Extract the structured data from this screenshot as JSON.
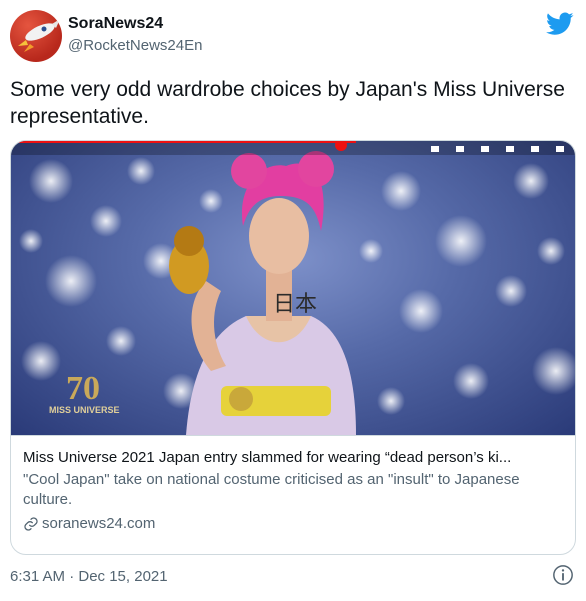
{
  "account": {
    "display_name": "SoraNews24",
    "handle": "@RocketNews24En"
  },
  "icons": {
    "avatar": "rocket-avatar-icon",
    "brand": "twitter-bird-icon",
    "link": "link-icon",
    "info": "info-icon"
  },
  "tweet": {
    "text": "Some very odd wardrobe choices by Japan's Miss Universe representative."
  },
  "card": {
    "title": "Miss Universe 2021 Japan entry slammed for wearing “dead person’s ki...",
    "description": "\"Cool Japan\" take on national costume criticised as an \"insult\" to Japanese culture.",
    "domain": "soranews24.com",
    "image_watermark_number": "70",
    "image_watermark_text": "MISS UNIVERSE",
    "image_body_text": "日本"
  },
  "footer": {
    "timestamp": "6:31 AM · Dec 15, 2021"
  },
  "colors": {
    "brand_blue": "#1d9bf0",
    "secondary_text": "#536471",
    "primary_text": "#0f1419",
    "border": "#cfd9de"
  }
}
